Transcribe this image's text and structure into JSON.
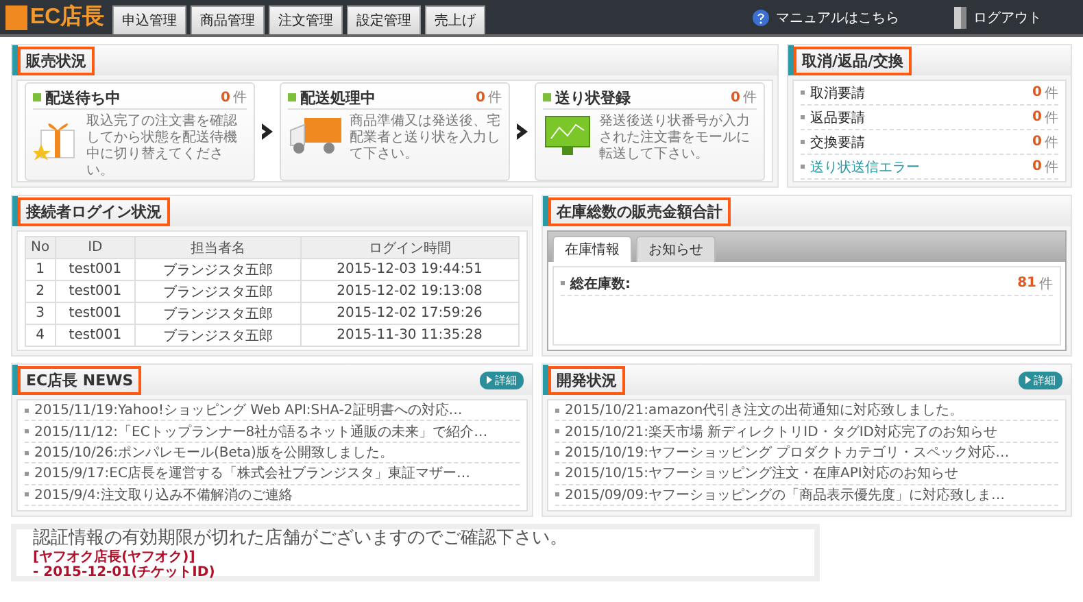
{
  "header": {
    "logo": "EC店長",
    "nav": [
      {
        "label": "申込管理",
        "selected": false
      },
      {
        "label": "商品管理",
        "selected": false
      },
      {
        "label": "注文管理",
        "selected": false
      },
      {
        "label": "設定管理",
        "selected": false
      },
      {
        "label": "売上げ",
        "selected": false
      }
    ],
    "manual": "マニュアルはこちら",
    "logout": "ログアウト"
  },
  "sales_status": {
    "title": "販売状況",
    "steps": [
      {
        "kind": "gift",
        "title": "配送待ち中",
        "count": "0",
        "unit": "件",
        "description": "取込完了の注文書を確認してから状態を配送待機中に切り替えてください。"
      },
      {
        "kind": "truck",
        "title": "配送処理中",
        "count": "0",
        "unit": "件",
        "description": "商品準備又は発送後、宅配業者と送り状を入力して下さい。"
      },
      {
        "kind": "monitor",
        "title": "送り状登録",
        "count": "0",
        "unit": "件",
        "description": "発送後送り状番号が入力された注文書をモールに転送して下さい。"
      }
    ]
  },
  "returns": {
    "title": "取消/返品/交換",
    "items": [
      {
        "label": "取消要請",
        "count": "0",
        "unit": "件",
        "link": false
      },
      {
        "label": "返品要請",
        "count": "0",
        "unit": "件",
        "link": false
      },
      {
        "label": "交換要請",
        "count": "0",
        "unit": "件",
        "link": false
      },
      {
        "label": "送り状送信エラー",
        "count": "0",
        "unit": "件",
        "link": true
      }
    ]
  },
  "login_status": {
    "title": "接続者ログイン状況",
    "columns": [
      "No",
      "ID",
      "担当者名",
      "ログイン時間"
    ],
    "rows": [
      [
        "1",
        "test001",
        "ブランジスタ五郎",
        "2015-12-03 19:44:51"
      ],
      [
        "2",
        "test001",
        "ブランジスタ五郎",
        "2015-12-02 19:13:08"
      ],
      [
        "3",
        "test001",
        "ブランジスタ五郎",
        "2015-12-02 17:59:26"
      ],
      [
        "4",
        "test001",
        "ブランジスタ五郎",
        "2015-11-30 11:35:28"
      ]
    ]
  },
  "inventory": {
    "title": "在庫総数の販売金額合計",
    "tabs": [
      {
        "label": "在庫情報",
        "selected": true
      },
      {
        "label": "お知らせ",
        "selected": false
      }
    ],
    "label": "総在庫数:",
    "value": "81",
    "unit": "件"
  },
  "news": {
    "title": "EC店長 NEWS",
    "detail": "詳細",
    "items": [
      "2015/11/19:Yahoo!ショッピング Web API:SHA-2証明書への対応…",
      "2015/11/12:「ECトップランナー8社が語るネット通販の未来」で紹介…",
      "2015/10/26:ポンパレモール(Beta)版を公開致しました。",
      "2015/9/17:EC店長を運営する「株式会社ブランジスタ」東証マザー…",
      "2015/9/4:注文取り込み不備解消のご連絡"
    ]
  },
  "development": {
    "title": "開発状況",
    "detail": "詳細",
    "items": [
      "2015/10/21:amazon代引き注文の出荷通知に対応致しました。",
      "2015/10/21:楽天市場 新ディレクトリID・タグID対応完了のお知らせ",
      "2015/10/19:ヤフーショッピング プロダクトカテゴリ・スペック対応…",
      "2015/10/15:ヤフーショッピング注文・在庫API対応のお知らせ",
      "2015/09/09:ヤフーショッピングの「商品表示優先度」に対応致しま…"
    ]
  },
  "notice": {
    "message": "認証情報の有効期限が切れた店舗がございますのでご確認下さい。",
    "shop": "[ヤフオク店長(ヤフオク)]",
    "ticket": "- 2015-12-01(チケットID)"
  }
}
